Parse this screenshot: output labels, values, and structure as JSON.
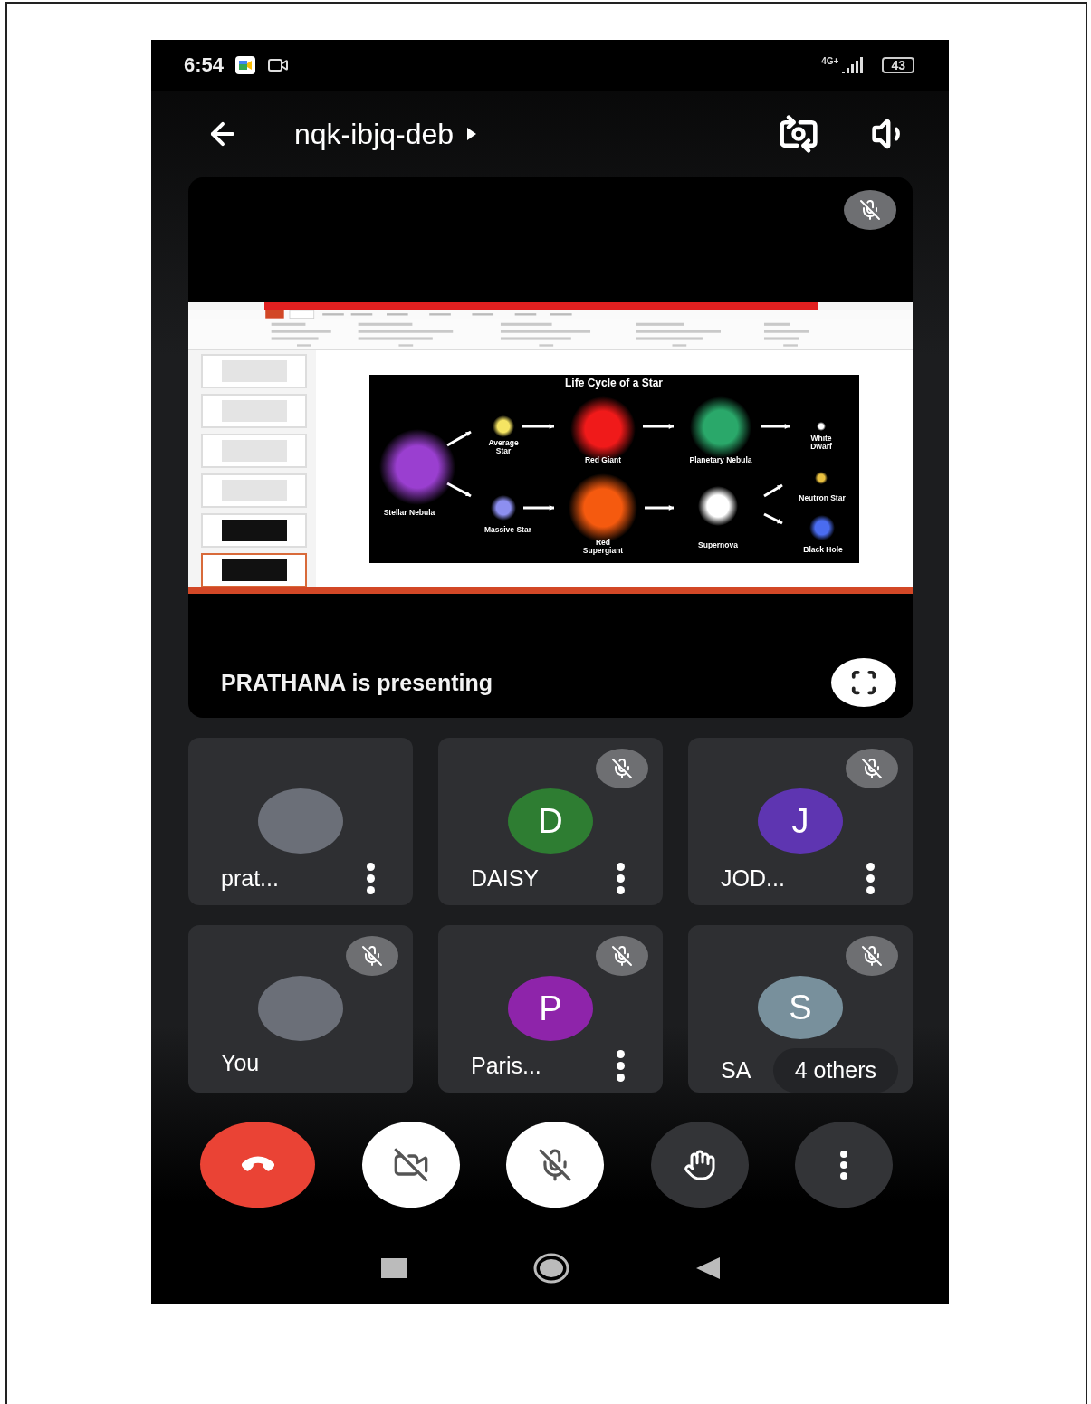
{
  "status_bar": {
    "time": "6:54",
    "network": "4G+",
    "battery": "43"
  },
  "header": {
    "meeting_code": "nqk-ibjq-deb"
  },
  "presentation": {
    "muted": true,
    "presenter_text": "PRATHANA is presenting",
    "shared_screen": {
      "thumbnails": [
        {
          "selected": false
        },
        {
          "selected": false
        },
        {
          "selected": false
        },
        {
          "selected": false
        },
        {
          "selected": false
        },
        {
          "selected": true
        }
      ],
      "slide_title": "Life Cycle of a Star",
      "slide_labels": [
        {
          "label": "Stellar Nebula",
          "color": "#9a3fd0"
        },
        {
          "label": "Average Star",
          "color": "#f5e463"
        },
        {
          "label": "Red Giant",
          "color": "#f01a1a"
        },
        {
          "label": "Planetary Nebula",
          "color": "#2aa86a"
        },
        {
          "label": "White Dwarf",
          "color": "#ffffff"
        },
        {
          "label": "Massive Star",
          "color": "#8d8ff0"
        },
        {
          "label": "Red Supergiant",
          "color": "#f55a0f"
        },
        {
          "label": "Supernova",
          "color": "#ffffff"
        },
        {
          "label": "Neutron Star",
          "color": "#e8c040"
        },
        {
          "label": "Black Hole",
          "color": "#4a6cf0"
        }
      ]
    }
  },
  "participants": [
    {
      "name": "prat...",
      "muted": false,
      "menu": true,
      "avatar": {
        "kind": "photo"
      }
    },
    {
      "name": "DAISY",
      "muted": true,
      "menu": true,
      "avatar": {
        "kind": "letter",
        "letter": "D",
        "color": "#2e7d32"
      }
    },
    {
      "name": "JOD...",
      "muted": true,
      "menu": true,
      "avatar": {
        "kind": "letter",
        "letter": "J",
        "color": "#5e35b1"
      }
    },
    {
      "name": "You",
      "muted": true,
      "menu": false,
      "avatar": {
        "kind": "photo"
      }
    },
    {
      "name": "Paris...",
      "muted": true,
      "menu": true,
      "avatar": {
        "kind": "letter",
        "letter": "P",
        "color": "#8e24aa"
      }
    },
    {
      "name": "SA",
      "muted": true,
      "menu": false,
      "avatar": {
        "kind": "letter",
        "letter": "S",
        "color": "#78909c"
      },
      "others_badge": "4 others"
    }
  ],
  "controls": [
    {
      "kind": "end_call"
    },
    {
      "kind": "camera",
      "on": false
    },
    {
      "kind": "mic",
      "on": false
    },
    {
      "kind": "raise_hand"
    },
    {
      "kind": "more"
    }
  ]
}
